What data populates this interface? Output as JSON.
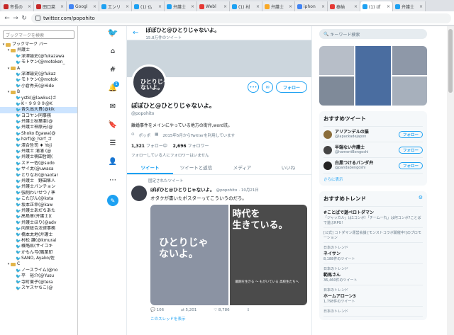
{
  "browser": {
    "tabs": [
      {
        "label": "市長の",
        "color": "#c62828"
      },
      {
        "label": "田口菜",
        "color": "#c62828"
      },
      {
        "label": "Googl",
        "color": "#4285f4"
      },
      {
        "label": "エンリ",
        "color": "#1da1f2"
      },
      {
        "label": "(1) 仏",
        "color": "#1da1f2"
      },
      {
        "label": "弁護士",
        "color": "#1da1f2"
      },
      {
        "label": "Webl",
        "color": "#e53935"
      },
      {
        "label": "(1) 村",
        "color": "#1da1f2"
      },
      {
        "label": "弁護士",
        "color": "#f9a825"
      },
      {
        "label": "iphon",
        "color": "#4285f4"
      },
      {
        "label": "泰納",
        "color": "#e53935"
      },
      {
        "label": "(1) ぽ",
        "color": "#1da1f2",
        "active": true
      },
      {
        "label": "弁護士",
        "color": "#1da1f2"
      }
    ],
    "close_glyph": "×",
    "url": "twitter.com/popohito",
    "back_glyph": "←",
    "forward_glyph": "→",
    "reload_glyph": "↻"
  },
  "sidebar": {
    "search_placeholder": "ブックマークを検索",
    "items": [
      {
        "label": "ブックマーク バー",
        "kind": "folder",
        "depth": 0,
        "open": "▾"
      },
      {
        "label": "弁護士",
        "kind": "folder",
        "depth": 1,
        "open": "▾"
      },
      {
        "label": "深澤諭史(@fukazawa",
        "kind": "bird",
        "depth": 2
      },
      {
        "label": "モトケン(@motoken_",
        "kind": "bird",
        "depth": 2
      },
      {
        "label": "A",
        "kind": "folder",
        "depth": 1,
        "open": "▾"
      },
      {
        "label": "深澤諭史(@fukaz",
        "kind": "bird",
        "depth": 2
      },
      {
        "label": "モトケン(@motok",
        "kind": "bird",
        "depth": 2
      },
      {
        "label": "小倉秀夫(@Hide",
        "kind": "bird",
        "depth": 2
      },
      {
        "label": "B",
        "kind": "folder",
        "depth": 1,
        "open": "▾"
      },
      {
        "label": "ystk(@lawkus)さ",
        "kind": "bird",
        "depth": 2
      },
      {
        "label": "K・９９９９@K",
        "kind": "bird",
        "depth": 2
      },
      {
        "label": "晋久出大貴(@kik",
        "kind": "bird",
        "depth": 2,
        "selected": true
      },
      {
        "label": "ヨコヤン同事務",
        "kind": "bird",
        "depth": 2
      },
      {
        "label": "弁護士秋葉亜(@",
        "kind": "bird",
        "depth": 2
      },
      {
        "label": "弁護士神原元(@",
        "kind": "bird",
        "depth": 2
      },
      {
        "label": "Shoko Egawa(@",
        "kind": "bird",
        "depth": 2
      },
      {
        "label": "hzrf(@_hzrf_さ",
        "kind": "bird",
        "depth": 2
      },
      {
        "label": "濱合哲司 ♦ Yoji",
        "kind": "bird",
        "depth": 2
      },
      {
        "label": "弁護士 浦浦 (@",
        "kind": "bird",
        "depth": 2
      },
      {
        "label": "弁護士楠田哲朗(",
        "kind": "bird",
        "depth": 2
      },
      {
        "label": "スド一佐(@sudo",
        "kind": "bird",
        "depth": 2
      },
      {
        "label": "サイ太(@uwasa",
        "kind": "bird",
        "depth": 2
      },
      {
        "label": "とりなお(@naotar",
        "kind": "bird",
        "depth": 2
      },
      {
        "label": "弁護士　野田隼人",
        "kind": "bird",
        "depth": 2
      },
      {
        "label": "弁護士パンチョン",
        "kind": "bird",
        "depth": 2
      },
      {
        "label": "強制わいせつ / 準",
        "kind": "bird",
        "depth": 2
      },
      {
        "label": "こたぴん(@kota",
        "kind": "bird",
        "depth": 2
      },
      {
        "label": "坂本正幸(@kaw",
        "kind": "bird",
        "depth": 2
      },
      {
        "label": "弁護士あだちあた",
        "kind": "bird",
        "depth": 2
      },
      {
        "label": "高島章(弁護士)(",
        "kind": "bird",
        "depth": 2
      },
      {
        "label": "弁護士ほり(@adv",
        "kind": "bird",
        "depth": 2
      },
      {
        "label": "向原総合法律事務",
        "kind": "bird",
        "depth": 2
      },
      {
        "label": "橋本太地(弁護士",
        "kind": "bird",
        "depth": 2
      },
      {
        "label": "村松 謙(@kmurai",
        "kind": "bird",
        "depth": 2
      },
      {
        "label": "概略県(サイコキ",
        "kind": "bird",
        "depth": 2
      },
      {
        "label": "かもん弓(職業印",
        "kind": "bird",
        "depth": 2
      },
      {
        "label": "SANO, Ayako/佐",
        "kind": "bird",
        "depth": 2
      },
      {
        "label": "C",
        "kind": "folder",
        "depth": 1,
        "open": "▾"
      },
      {
        "label": "ノースライム(@no",
        "kind": "bird",
        "depth": 2
      },
      {
        "label": "平　裕介(@Yusu",
        "kind": "bird",
        "depth": 2
      },
      {
        "label": "寺町東子(@tera",
        "kind": "bird",
        "depth": 2
      },
      {
        "label": "スヤスヤちこ(@",
        "kind": "bird",
        "depth": 2
      }
    ]
  },
  "rail": {
    "icons": [
      "twitter-logo-icon",
      "hash-icon",
      "explore-icon",
      "bell-icon",
      "mail-icon",
      "bookmark-icon",
      "list-icon",
      "profile-icon",
      "more-icon",
      "compose-icon"
    ],
    "notification_count": "1"
  },
  "profile": {
    "header_name": "ぽぽひと@ひとりじゃないよ。",
    "header_tweets": "15.8万件のツイート",
    "avatar_text": "ひとりじゃ\nないよ。",
    "name": "ぽぽひと@ひとりじゃないよ。",
    "handle": "@popohito",
    "bio": "離婚事件をメインにやっている地方の街弁,word洗。",
    "location": "ポッポ",
    "joined": "2015年5月からTwitterを利用しています",
    "following_count": "1,321",
    "following_label": "フォロー中",
    "followers_count": "2,696",
    "followers_label": "フォロワー",
    "followed_by": "フォローしている人にフォロワーはいません",
    "more_button": "•••",
    "mail_button": "✉",
    "follow_button": "フォロー"
  },
  "tabs": [
    "ツイート",
    "ツイートと返信",
    "メディア",
    "いいね"
  ],
  "tweet": {
    "pinned_label": "固定されたツイート",
    "author": "ぽぽひと@ひとりじゃないよ。",
    "handle": "@popohito",
    "date": "· 10月21日",
    "text": "オタクが書いたポスターってこういうのだろ。",
    "img1_text": "ひとりじゃ\nないよ。",
    "img2_text": "時代を\n生きている。",
    "img2_caption": "最期を生きる 〜 もがいている 高校生たちへ",
    "reply_count": "106",
    "retweet_count": "5,201",
    "like_count": "8,786",
    "thread_link": "このスレッドを表示"
  },
  "right": {
    "search_placeholder": "キーワード検索",
    "reco_title": "おすすめツイート",
    "recos": [
      {
        "name": "アリアンデルの猫",
        "handle": "@lapackadejapon",
        "button": "フォロー"
      },
      {
        "name": "半端ない弁護士",
        "handle": "@hamentBengoshi",
        "button": "フォロー"
      },
      {
        "name": "白黒つけるパンダ弁",
        "handle": "@pandabengoshi",
        "button": "フォロー"
      }
    ],
    "more_link": "さらに表示",
    "trend_title": "おすすめトレンド",
    "trends": [
      {
        "cat": "",
        "title": "#ことばで遊べロトダマン",
        "desc": "「ジャッカル」は1コンボ!「チーム一丸」は何コンボ?ことばで遊ぶRPG!"
      },
      {
        "cat": "",
        "title": "",
        "desc": "[公式] コトダマン運営会議 [モンストコラボ開催中!]のプロモーション"
      },
      {
        "cat": "日本のトレンド",
        "title": "ネイサン",
        "desc": "8,188件のツイート"
      },
      {
        "cat": "日本のトレンド",
        "title": "範馬さん",
        "desc": "36,460件のツイート"
      },
      {
        "cat": "日本のトレンド",
        "title": "ホームアローン3",
        "desc": "1,798件のツイート"
      },
      {
        "cat": "日本のトレンド",
        "title": "",
        "desc": ""
      }
    ]
  }
}
